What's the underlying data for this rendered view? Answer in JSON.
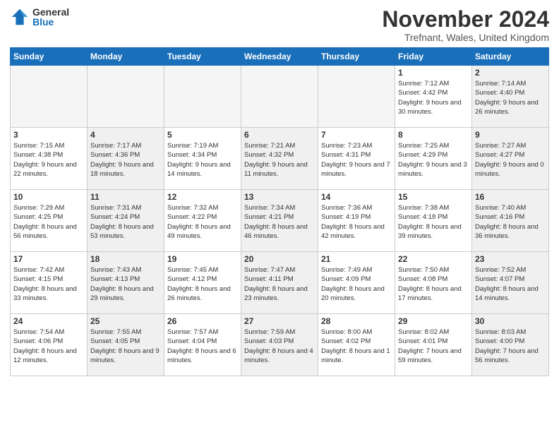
{
  "logo": {
    "general": "General",
    "blue": "Blue"
  },
  "title": "November 2024",
  "location": "Trefnant, Wales, United Kingdom",
  "days_of_week": [
    "Sunday",
    "Monday",
    "Tuesday",
    "Wednesday",
    "Thursday",
    "Friday",
    "Saturday"
  ],
  "weeks": [
    [
      {
        "day": "",
        "info": "",
        "empty": true
      },
      {
        "day": "",
        "info": "",
        "empty": true
      },
      {
        "day": "",
        "info": "",
        "empty": true
      },
      {
        "day": "",
        "info": "",
        "empty": true
      },
      {
        "day": "",
        "info": "",
        "empty": true
      },
      {
        "day": "1",
        "info": "Sunrise: 7:12 AM\nSunset: 4:42 PM\nDaylight: 9 hours\nand 30 minutes.",
        "shaded": false
      },
      {
        "day": "2",
        "info": "Sunrise: 7:14 AM\nSunset: 4:40 PM\nDaylight: 9 hours\nand 26 minutes.",
        "shaded": true
      }
    ],
    [
      {
        "day": "3",
        "info": "Sunrise: 7:15 AM\nSunset: 4:38 PM\nDaylight: 9 hours\nand 22 minutes.",
        "shaded": false
      },
      {
        "day": "4",
        "info": "Sunrise: 7:17 AM\nSunset: 4:36 PM\nDaylight: 9 hours\nand 18 minutes.",
        "shaded": true
      },
      {
        "day": "5",
        "info": "Sunrise: 7:19 AM\nSunset: 4:34 PM\nDaylight: 9 hours\nand 14 minutes.",
        "shaded": false
      },
      {
        "day": "6",
        "info": "Sunrise: 7:21 AM\nSunset: 4:32 PM\nDaylight: 9 hours\nand 11 minutes.",
        "shaded": true
      },
      {
        "day": "7",
        "info": "Sunrise: 7:23 AM\nSunset: 4:31 PM\nDaylight: 9 hours\nand 7 minutes.",
        "shaded": false
      },
      {
        "day": "8",
        "info": "Sunrise: 7:25 AM\nSunset: 4:29 PM\nDaylight: 9 hours\nand 3 minutes.",
        "shaded": false
      },
      {
        "day": "9",
        "info": "Sunrise: 7:27 AM\nSunset: 4:27 PM\nDaylight: 9 hours\nand 0 minutes.",
        "shaded": true
      }
    ],
    [
      {
        "day": "10",
        "info": "Sunrise: 7:29 AM\nSunset: 4:25 PM\nDaylight: 8 hours\nand 56 minutes.",
        "shaded": false
      },
      {
        "day": "11",
        "info": "Sunrise: 7:31 AM\nSunset: 4:24 PM\nDaylight: 8 hours\nand 53 minutes.",
        "shaded": true
      },
      {
        "day": "12",
        "info": "Sunrise: 7:32 AM\nSunset: 4:22 PM\nDaylight: 8 hours\nand 49 minutes.",
        "shaded": false
      },
      {
        "day": "13",
        "info": "Sunrise: 7:34 AM\nSunset: 4:21 PM\nDaylight: 8 hours\nand 46 minutes.",
        "shaded": true
      },
      {
        "day": "14",
        "info": "Sunrise: 7:36 AM\nSunset: 4:19 PM\nDaylight: 8 hours\nand 42 minutes.",
        "shaded": false
      },
      {
        "day": "15",
        "info": "Sunrise: 7:38 AM\nSunset: 4:18 PM\nDaylight: 8 hours\nand 39 minutes.",
        "shaded": false
      },
      {
        "day": "16",
        "info": "Sunrise: 7:40 AM\nSunset: 4:16 PM\nDaylight: 8 hours\nand 36 minutes.",
        "shaded": true
      }
    ],
    [
      {
        "day": "17",
        "info": "Sunrise: 7:42 AM\nSunset: 4:15 PM\nDaylight: 8 hours\nand 33 minutes.",
        "shaded": false
      },
      {
        "day": "18",
        "info": "Sunrise: 7:43 AM\nSunset: 4:13 PM\nDaylight: 8 hours\nand 29 minutes.",
        "shaded": true
      },
      {
        "day": "19",
        "info": "Sunrise: 7:45 AM\nSunset: 4:12 PM\nDaylight: 8 hours\nand 26 minutes.",
        "shaded": false
      },
      {
        "day": "20",
        "info": "Sunrise: 7:47 AM\nSunset: 4:11 PM\nDaylight: 8 hours\nand 23 minutes.",
        "shaded": true
      },
      {
        "day": "21",
        "info": "Sunrise: 7:49 AM\nSunset: 4:09 PM\nDaylight: 8 hours\nand 20 minutes.",
        "shaded": false
      },
      {
        "day": "22",
        "info": "Sunrise: 7:50 AM\nSunset: 4:08 PM\nDaylight: 8 hours\nand 17 minutes.",
        "shaded": false
      },
      {
        "day": "23",
        "info": "Sunrise: 7:52 AM\nSunset: 4:07 PM\nDaylight: 8 hours\nand 14 minutes.",
        "shaded": true
      }
    ],
    [
      {
        "day": "24",
        "info": "Sunrise: 7:54 AM\nSunset: 4:06 PM\nDaylight: 8 hours\nand 12 minutes.",
        "shaded": false
      },
      {
        "day": "25",
        "info": "Sunrise: 7:55 AM\nSunset: 4:05 PM\nDaylight: 8 hours\nand 9 minutes.",
        "shaded": true
      },
      {
        "day": "26",
        "info": "Sunrise: 7:57 AM\nSunset: 4:04 PM\nDaylight: 8 hours\nand 6 minutes.",
        "shaded": false
      },
      {
        "day": "27",
        "info": "Sunrise: 7:59 AM\nSunset: 4:03 PM\nDaylight: 8 hours\nand 4 minutes.",
        "shaded": true
      },
      {
        "day": "28",
        "info": "Sunrise: 8:00 AM\nSunset: 4:02 PM\nDaylight: 8 hours\nand 1 minute.",
        "shaded": false
      },
      {
        "day": "29",
        "info": "Sunrise: 8:02 AM\nSunset: 4:01 PM\nDaylight: 7 hours\nand 59 minutes.",
        "shaded": false
      },
      {
        "day": "30",
        "info": "Sunrise: 8:03 AM\nSunset: 4:00 PM\nDaylight: 7 hours\nand 56 minutes.",
        "shaded": true
      }
    ]
  ]
}
